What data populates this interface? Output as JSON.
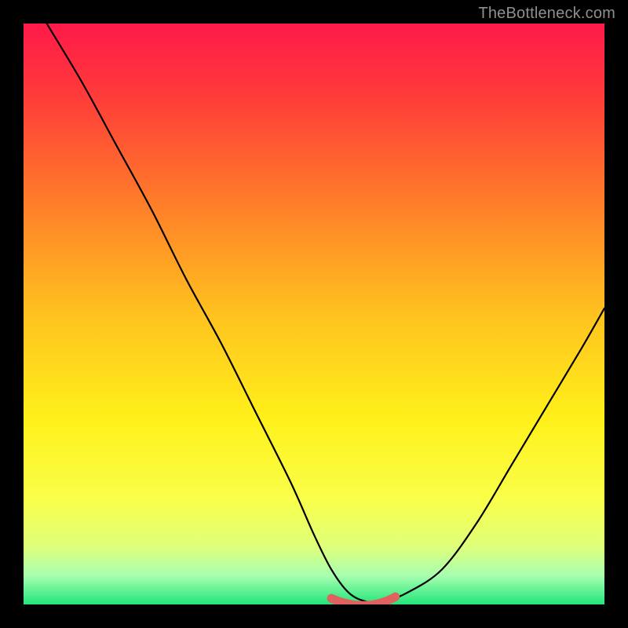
{
  "watermark": {
    "text": "TheBottleneck.com"
  },
  "colors": {
    "background": "#000000",
    "watermark": "#8f8f8f",
    "curve": "#000000",
    "highlight": "#e0625f",
    "gradient_stops": [
      {
        "offset": 0.0,
        "color": "#ff1a4a"
      },
      {
        "offset": 0.12,
        "color": "#ff3a3a"
      },
      {
        "offset": 0.3,
        "color": "#ff7a2a"
      },
      {
        "offset": 0.5,
        "color": "#ffc21f"
      },
      {
        "offset": 0.68,
        "color": "#fff01a"
      },
      {
        "offset": 0.82,
        "color": "#f9ff4a"
      },
      {
        "offset": 0.9,
        "color": "#dfff7a"
      },
      {
        "offset": 0.95,
        "color": "#a8ffb0"
      },
      {
        "offset": 1.0,
        "color": "#22e57a"
      }
    ]
  },
  "chart_data": {
    "type": "line",
    "title": "",
    "xlabel": "",
    "ylabel": "",
    "xlim": [
      0,
      100
    ],
    "ylim": [
      0,
      100
    ],
    "note": "Axes are unlabeled in the image; values are normalized 0–100 from visual estimation. y represents deviation/bottleneck percentage (0 = perfect match, higher = worse).",
    "series": [
      {
        "name": "bottleneck-curve",
        "x": [
          4,
          10,
          16,
          22,
          28,
          34,
          40,
          46,
          50,
          53,
          56,
          59,
          62,
          66,
          72,
          78,
          84,
          90,
          96,
          100
        ],
        "y": [
          100,
          90,
          79,
          68,
          56,
          45,
          33,
          21,
          12,
          6,
          2,
          0.5,
          0.5,
          2,
          6,
          14,
          24,
          34,
          44,
          51
        ]
      }
    ],
    "highlight_region": {
      "name": "optimal-range",
      "x_start": 53,
      "x_end": 64,
      "y_level": 0.5
    }
  }
}
